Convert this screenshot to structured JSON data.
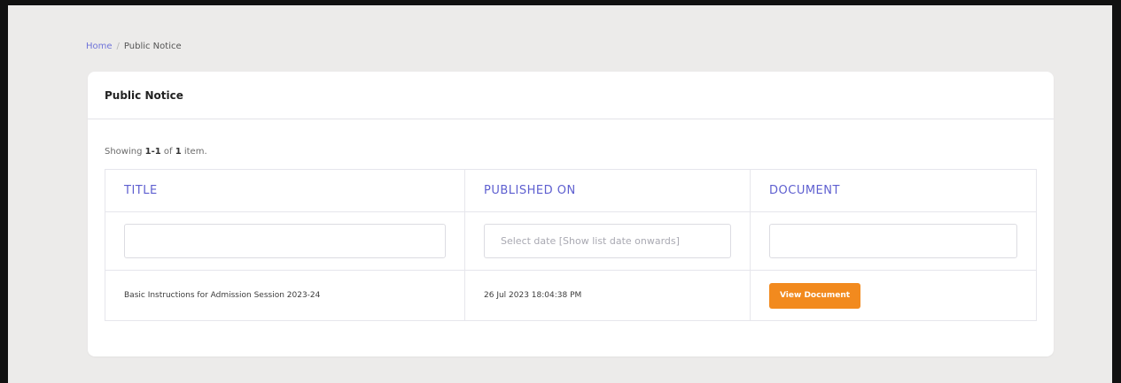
{
  "breadcrumb": {
    "home": "Home",
    "separator": "/",
    "current": "Public Notice"
  },
  "card": {
    "title": "Public Notice"
  },
  "summary": {
    "prefix": "Showing ",
    "range": "1-1",
    "middle": " of ",
    "total": "1",
    "suffix": " item."
  },
  "table": {
    "columns": [
      "TITLE",
      "PUBLISHED ON",
      "DOCUMENT"
    ],
    "filters": {
      "title_value": "",
      "title_placeholder": "",
      "published_value": "",
      "published_placeholder": "Select date [Show list date onwards]",
      "document_value": "",
      "document_placeholder": ""
    },
    "rows": [
      {
        "title": "Basic Instructions for Admission Session 2023-24",
        "published_on": "26 Jul 2023 18:04:38 PM",
        "document_button": "View Document"
      }
    ]
  },
  "colors": {
    "accent": "#5e5fd0",
    "link": "#6f74d9",
    "button": "#f28a1e",
    "background": "#ecebea"
  }
}
